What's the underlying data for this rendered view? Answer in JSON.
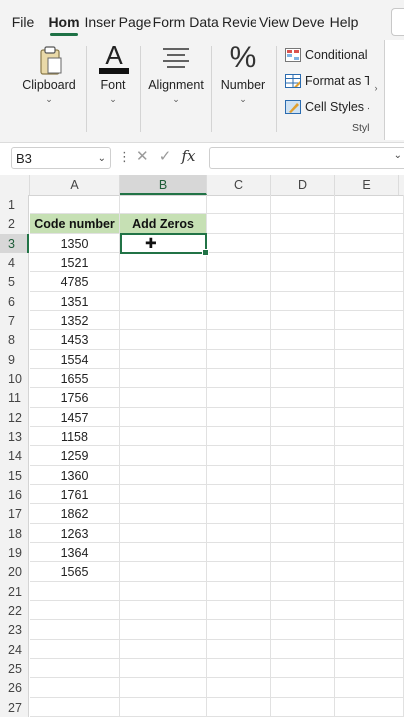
{
  "tabs": [
    "File",
    "Home",
    "Insert",
    "Page",
    "Formulas",
    "Data",
    "Review",
    "View",
    "Developer",
    "Help"
  ],
  "tabs_display": [
    "File",
    "Hom",
    "Inser",
    "Page",
    "Form",
    "Data",
    "Revie",
    "View",
    "Deve",
    "Help"
  ],
  "ribbon": {
    "clipboard": "Clipboard",
    "font": "Font",
    "alignment": "Alignment",
    "number": "Number",
    "conditional": "Conditional",
    "format_as": "Format as T",
    "cell_styles": "Cell Styles",
    "styles_group": "Styl"
  },
  "formula_bar": {
    "name_box": "B3",
    "fx": "fx",
    "value": ""
  },
  "columns": [
    "A",
    "B",
    "C",
    "D",
    "E"
  ],
  "selected_column": "B",
  "selected_row": 3,
  "headers": {
    "A2": "Code number",
    "B2": "Add Zeros"
  },
  "rows": [
    {
      "n": "1",
      "a": ""
    },
    {
      "n": "2",
      "a": ""
    },
    {
      "n": "3",
      "a": "1350"
    },
    {
      "n": "4",
      "a": "1521"
    },
    {
      "n": "5",
      "a": "4785"
    },
    {
      "n": "6",
      "a": "1351"
    },
    {
      "n": "7",
      "a": "1352"
    },
    {
      "n": "8",
      "a": "1453"
    },
    {
      "n": "9",
      "a": "1554"
    },
    {
      "n": "10",
      "a": "1655"
    },
    {
      "n": "11",
      "a": "1756"
    },
    {
      "n": "12",
      "a": "1457"
    },
    {
      "n": "13",
      "a": "1158"
    },
    {
      "n": "14",
      "a": "1259"
    },
    {
      "n": "15",
      "a": "1360"
    },
    {
      "n": "16",
      "a": "1761"
    },
    {
      "n": "17",
      "a": "1862"
    },
    {
      "n": "18",
      "a": "1263"
    },
    {
      "n": "19",
      "a": "1364"
    },
    {
      "n": "20",
      "a": "1565"
    },
    {
      "n": "21",
      "a": ""
    },
    {
      "n": "22",
      "a": ""
    },
    {
      "n": "23",
      "a": ""
    },
    {
      "n": "24",
      "a": ""
    },
    {
      "n": "25",
      "a": ""
    },
    {
      "n": "26",
      "a": ""
    },
    {
      "n": "27",
      "a": ""
    }
  ],
  "colors": {
    "accent": "#217346",
    "header_fill": "#c6e0b4"
  }
}
